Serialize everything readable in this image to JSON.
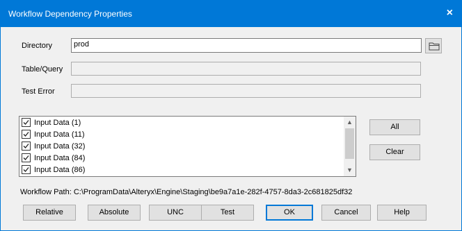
{
  "background": {
    "fragment": "s"
  },
  "dialog": {
    "title": "Workflow Dependency Properties",
    "close": "×"
  },
  "fields": {
    "directory": {
      "label": "Directory",
      "value": "prod"
    },
    "table_query": {
      "label": "Table/Query",
      "value": ""
    },
    "test_error": {
      "label": "Test Error",
      "value": ""
    }
  },
  "dependencies": [
    {
      "label": "Input Data (1)",
      "checked": true
    },
    {
      "label": "Input Data (11)",
      "checked": true
    },
    {
      "label": "Input Data (32)",
      "checked": true
    },
    {
      "label": "Input Data (84)",
      "checked": true
    },
    {
      "label": "Input Data (86)",
      "checked": true
    }
  ],
  "side_buttons": {
    "all": "All",
    "clear": "Clear"
  },
  "workflow_path": "Workflow Path: C:\\ProgramData\\Alteryx\\Engine\\Staging\\be9a7a1e-282f-4757-8da3-2c681825df32",
  "buttons": {
    "relative": "Relative",
    "absolute": "Absolute",
    "unc": "UNC",
    "test": "Test",
    "ok": "OK",
    "cancel": "Cancel",
    "help": "Help"
  },
  "colors": {
    "accent": "#0078d7",
    "dialog_bg": "#f0f0f0",
    "button_bg": "#e1e1e1"
  }
}
